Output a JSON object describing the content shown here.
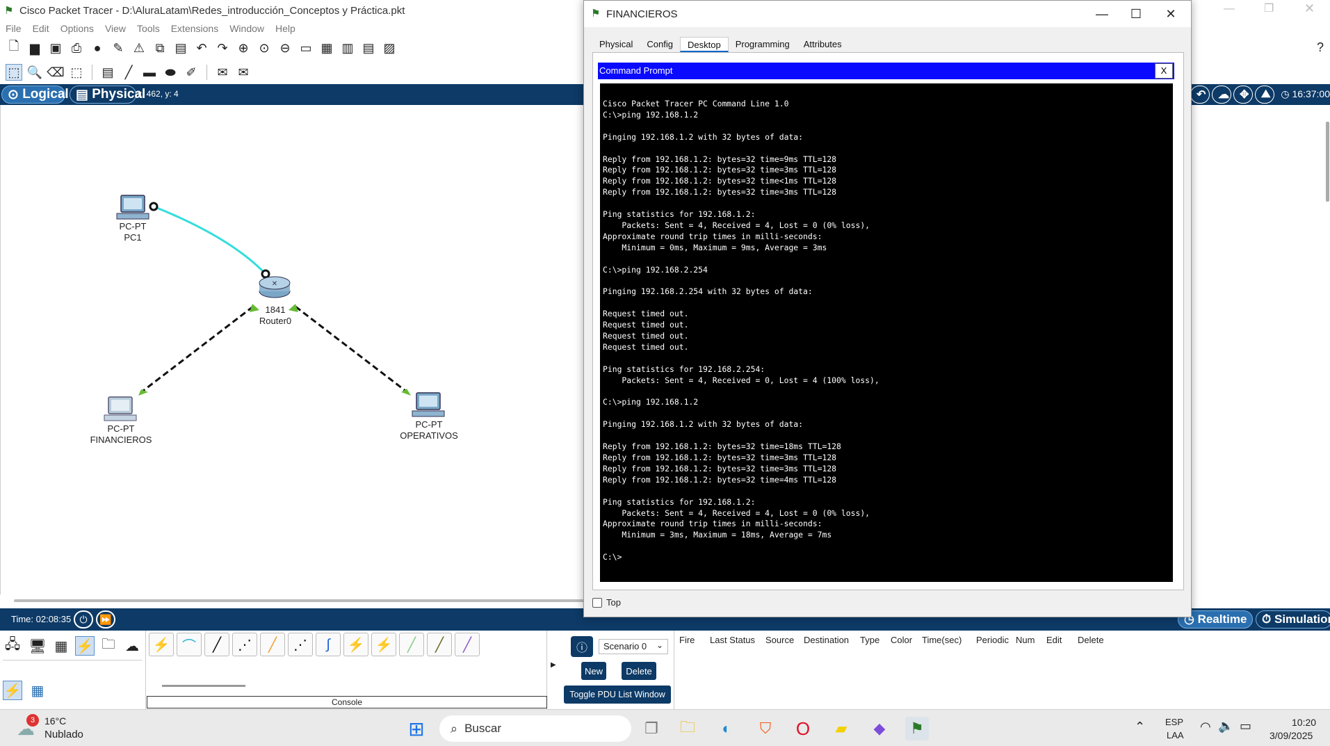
{
  "app": {
    "title": "Cisco Packet Tracer - D:\\AluraLatam\\Redes_introducción_Conceptos y Práctica.pkt",
    "menu": [
      "File",
      "Edit",
      "Options",
      "View",
      "Tools",
      "Extensions",
      "Window",
      "Help"
    ],
    "help_icon": "?"
  },
  "modebar": {
    "logical_label": "Logical",
    "physical_label": "Physical",
    "coords": "x: 462, y: 4",
    "clock": "16:37:00"
  },
  "topology": {
    "nodes": [
      {
        "type": "PC-PT",
        "name": "PC1"
      },
      {
        "type": "1841",
        "name": "Router0"
      },
      {
        "type": "PC-PT",
        "name": "FINANCIEROS"
      },
      {
        "type": "PC-PT",
        "name": "OPERATIVOS"
      }
    ],
    "link_colors": {
      "console": "#33dddd",
      "ethernet": "#111111",
      "port_up": "#66bb33",
      "port_endpoint": "#111111"
    }
  },
  "timebar": {
    "time_label": "Time: 02:08:35",
    "realtime_label": "Realtime",
    "simulation_label": "Simulation"
  },
  "bottom_panel": {
    "console_label": "Console",
    "scenario": "Scenario 0",
    "new_label": "New",
    "delete_label": "Delete",
    "toggle_label": "Toggle PDU List Window",
    "pdu_columns": [
      "Fire",
      "Last Status",
      "Source",
      "Destination",
      "Type",
      "Color",
      "Time(sec)",
      "Periodic",
      "Num",
      "Edit",
      "Delete"
    ]
  },
  "pc_window": {
    "title": "FINANCIEROS",
    "tabs": [
      "Physical",
      "Config",
      "Desktop",
      "Programming",
      "Attributes"
    ],
    "active_tab": "Desktop",
    "command_prompt_title": "Command Prompt",
    "close_x": "X",
    "top_checkbox_label": "Top",
    "terminal_lines": [
      "Cisco Packet Tracer PC Command Line 1.0",
      "C:\\>ping 192.168.1.2",
      "",
      "Pinging 192.168.1.2 with 32 bytes of data:",
      "",
      "Reply from 192.168.1.2: bytes=32 time=9ms TTL=128",
      "Reply from 192.168.1.2: bytes=32 time=3ms TTL=128",
      "Reply from 192.168.1.2: bytes=32 time<1ms TTL=128",
      "Reply from 192.168.1.2: bytes=32 time=3ms TTL=128",
      "",
      "Ping statistics for 192.168.1.2:",
      "    Packets: Sent = 4, Received = 4, Lost = 0 (0% loss),",
      "Approximate round trip times in milli-seconds:",
      "    Minimum = 0ms, Maximum = 9ms, Average = 3ms",
      "",
      "C:\\>ping 192.168.2.254",
      "",
      "Pinging 192.168.2.254 with 32 bytes of data:",
      "",
      "Request timed out.",
      "Request timed out.",
      "Request timed out.",
      "Request timed out.",
      "",
      "Ping statistics for 192.168.2.254:",
      "    Packets: Sent = 4, Received = 0, Lost = 4 (100% loss),",
      "",
      "C:\\>ping 192.168.1.2",
      "",
      "Pinging 192.168.1.2 with 32 bytes of data:",
      "",
      "Reply from 192.168.1.2: bytes=32 time=18ms TTL=128",
      "Reply from 192.168.1.2: bytes=32 time=3ms TTL=128",
      "Reply from 192.168.1.2: bytes=32 time=3ms TTL=128",
      "Reply from 192.168.1.2: bytes=32 time=4ms TTL=128",
      "",
      "Ping statistics for 192.168.1.2:",
      "    Packets: Sent = 4, Received = 4, Lost = 0 (0% loss),",
      "Approximate round trip times in milli-seconds:",
      "    Minimum = 3ms, Maximum = 18ms, Average = 7ms",
      "",
      "C:\\>"
    ]
  },
  "taskbar": {
    "weather_temp": "16°C",
    "weather_desc": "Nublado",
    "weather_badge": "3",
    "search_placeholder": "Buscar",
    "lang_1": "ESP",
    "lang_2": "LAA",
    "time": "10:20",
    "date": "3/09/2025"
  }
}
